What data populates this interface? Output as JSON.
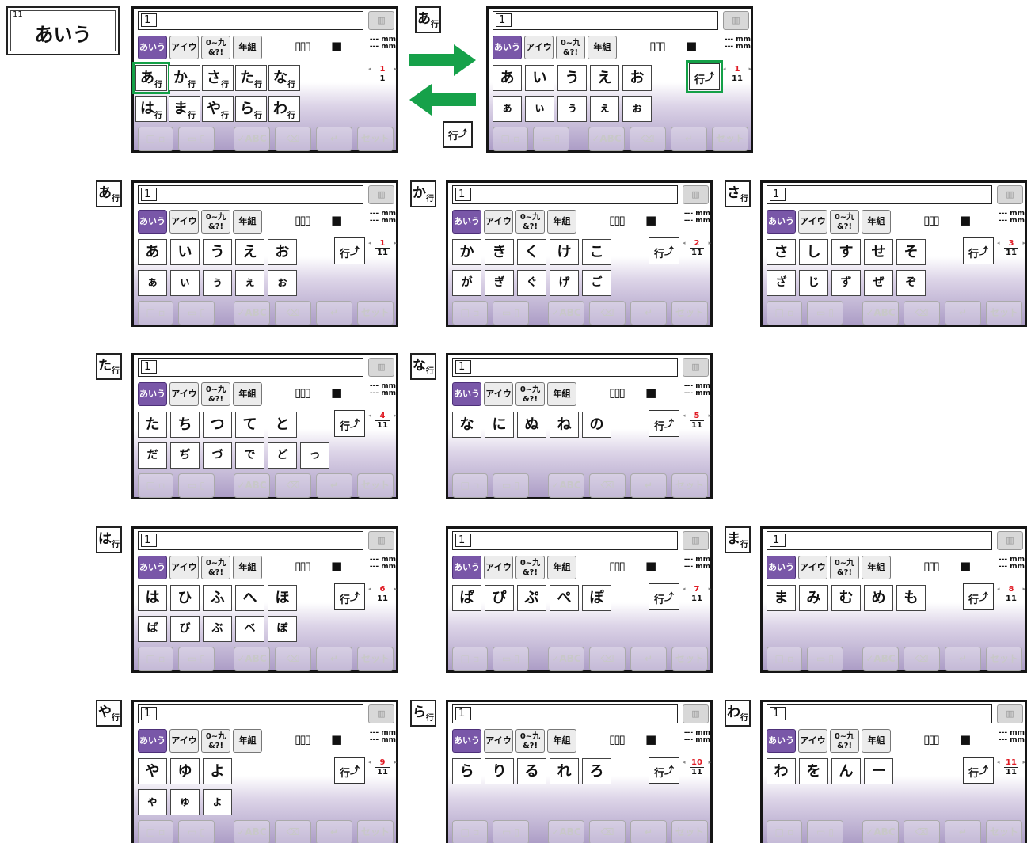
{
  "header": {
    "number": "11",
    "title": "あいう"
  },
  "ui": {
    "cursor": "1",
    "sewing_icon": "▥",
    "modes": [
      "あいう",
      "アイウ",
      "0~九\n&?!",
      "年組"
    ],
    "font_icon": "font-size-icon",
    "pattern_icon": "pattern-icon",
    "mm1": "--- mm",
    "mm2": "--- mm",
    "gyo_label": "行",
    "bottom": [
      "□ ▫",
      "▭ ▯",
      "✓ABC",
      "⌫",
      "↵",
      "セット"
    ]
  },
  "colors": {
    "active_mode": "#7957a8",
    "highlight": "#14a047",
    "arrow": "#16a14a",
    "page_num": "#e01b24"
  },
  "gyo_button_label": "行",
  "overview": {
    "label": "行",
    "row1": [
      "あ",
      "か",
      "さ",
      "た",
      "な"
    ],
    "row2": [
      "は",
      "ま",
      "や",
      "ら",
      "わ"
    ],
    "page": "1",
    "total": "1"
  },
  "detail0": {
    "row1": [
      "あ",
      "い",
      "う",
      "え",
      "お"
    ],
    "row2": [
      "ぁ",
      "ぃ",
      "ぅ",
      "ぇ",
      "ぉ"
    ],
    "page": "1",
    "total": "11"
  },
  "pages": [
    {
      "label": "あ",
      "sub": "行",
      "row1": [
        "あ",
        "い",
        "う",
        "え",
        "お"
      ],
      "row2": [
        "ぁ",
        "ぃ",
        "ぅ",
        "ぇ",
        "ぉ"
      ],
      "page": "1",
      "total": "11"
    },
    {
      "label": "か",
      "sub": "行",
      "row1": [
        "か",
        "き",
        "く",
        "け",
        "こ"
      ],
      "row2": [
        "が",
        "ぎ",
        "ぐ",
        "げ",
        "ご"
      ],
      "page": "2",
      "total": "11"
    },
    {
      "label": "さ",
      "sub": "行",
      "row1": [
        "さ",
        "し",
        "す",
        "せ",
        "そ"
      ],
      "row2": [
        "ざ",
        "じ",
        "ず",
        "ぜ",
        "ぞ"
      ],
      "page": "3",
      "total": "11"
    },
    {
      "label": "た",
      "sub": "行",
      "row1": [
        "た",
        "ち",
        "つ",
        "て",
        "と"
      ],
      "row2": [
        "だ",
        "ぢ",
        "づ",
        "で",
        "ど",
        "っ"
      ],
      "page": "4",
      "total": "11"
    },
    {
      "label": "な",
      "sub": "行",
      "row1": [
        "な",
        "に",
        "ぬ",
        "ね",
        "の"
      ],
      "row2": [],
      "page": "5",
      "total": "11"
    },
    {
      "label": "は",
      "sub": "行",
      "row1": [
        "は",
        "ひ",
        "ふ",
        "へ",
        "ほ"
      ],
      "row2": [
        "ば",
        "び",
        "ぶ",
        "べ",
        "ぼ"
      ],
      "page": "6",
      "total": "11"
    },
    {
      "label": "",
      "sub": "",
      "row1": [
        "ぱ",
        "ぴ",
        "ぷ",
        "ぺ",
        "ぽ"
      ],
      "row2": [],
      "page": "7",
      "total": "11"
    },
    {
      "label": "ま",
      "sub": "行",
      "row1": [
        "ま",
        "み",
        "む",
        "め",
        "も"
      ],
      "row2": [],
      "page": "8",
      "total": "11"
    },
    {
      "label": "や",
      "sub": "行",
      "row1": [
        "や",
        "ゆ",
        "よ"
      ],
      "row2": [
        "ゃ",
        "ゅ",
        "ょ"
      ],
      "page": "9",
      "total": "11"
    },
    {
      "label": "ら",
      "sub": "行",
      "row1": [
        "ら",
        "り",
        "る",
        "れ",
        "ろ"
      ],
      "row2": [],
      "page": "10",
      "total": "11"
    },
    {
      "label": "わ",
      "sub": "行",
      "row1": [
        "わ",
        "を",
        "ん",
        "ー"
      ],
      "row2": [],
      "page": "11",
      "total": "11"
    }
  ]
}
